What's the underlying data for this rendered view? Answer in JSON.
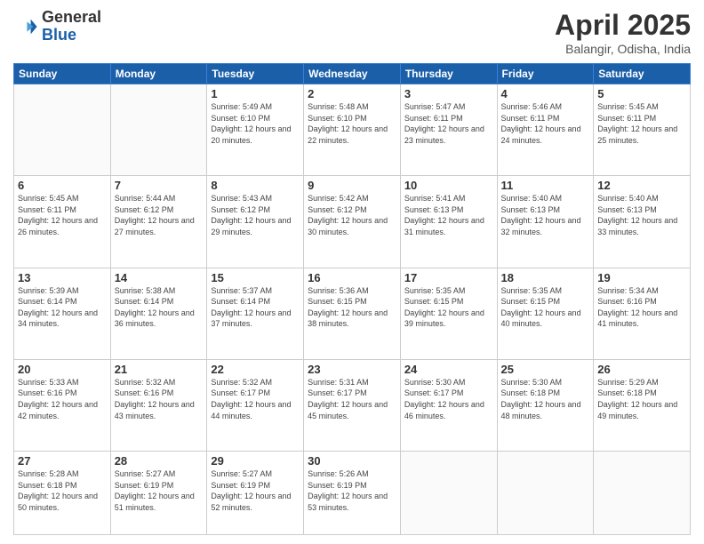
{
  "logo": {
    "general": "General",
    "blue": "Blue"
  },
  "title": "April 2025",
  "location": "Balangir, Odisha, India",
  "days_header": [
    "Sunday",
    "Monday",
    "Tuesday",
    "Wednesday",
    "Thursday",
    "Friday",
    "Saturday"
  ],
  "weeks": [
    [
      {
        "day": "",
        "info": ""
      },
      {
        "day": "",
        "info": ""
      },
      {
        "day": "1",
        "info": "Sunrise: 5:49 AM\nSunset: 6:10 PM\nDaylight: 12 hours and 20 minutes."
      },
      {
        "day": "2",
        "info": "Sunrise: 5:48 AM\nSunset: 6:10 PM\nDaylight: 12 hours and 22 minutes."
      },
      {
        "day": "3",
        "info": "Sunrise: 5:47 AM\nSunset: 6:11 PM\nDaylight: 12 hours and 23 minutes."
      },
      {
        "day": "4",
        "info": "Sunrise: 5:46 AM\nSunset: 6:11 PM\nDaylight: 12 hours and 24 minutes."
      },
      {
        "day": "5",
        "info": "Sunrise: 5:45 AM\nSunset: 6:11 PM\nDaylight: 12 hours and 25 minutes."
      }
    ],
    [
      {
        "day": "6",
        "info": "Sunrise: 5:45 AM\nSunset: 6:11 PM\nDaylight: 12 hours and 26 minutes."
      },
      {
        "day": "7",
        "info": "Sunrise: 5:44 AM\nSunset: 6:12 PM\nDaylight: 12 hours and 27 minutes."
      },
      {
        "day": "8",
        "info": "Sunrise: 5:43 AM\nSunset: 6:12 PM\nDaylight: 12 hours and 29 minutes."
      },
      {
        "day": "9",
        "info": "Sunrise: 5:42 AM\nSunset: 6:12 PM\nDaylight: 12 hours and 30 minutes."
      },
      {
        "day": "10",
        "info": "Sunrise: 5:41 AM\nSunset: 6:13 PM\nDaylight: 12 hours and 31 minutes."
      },
      {
        "day": "11",
        "info": "Sunrise: 5:40 AM\nSunset: 6:13 PM\nDaylight: 12 hours and 32 minutes."
      },
      {
        "day": "12",
        "info": "Sunrise: 5:40 AM\nSunset: 6:13 PM\nDaylight: 12 hours and 33 minutes."
      }
    ],
    [
      {
        "day": "13",
        "info": "Sunrise: 5:39 AM\nSunset: 6:14 PM\nDaylight: 12 hours and 34 minutes."
      },
      {
        "day": "14",
        "info": "Sunrise: 5:38 AM\nSunset: 6:14 PM\nDaylight: 12 hours and 36 minutes."
      },
      {
        "day": "15",
        "info": "Sunrise: 5:37 AM\nSunset: 6:14 PM\nDaylight: 12 hours and 37 minutes."
      },
      {
        "day": "16",
        "info": "Sunrise: 5:36 AM\nSunset: 6:15 PM\nDaylight: 12 hours and 38 minutes."
      },
      {
        "day": "17",
        "info": "Sunrise: 5:35 AM\nSunset: 6:15 PM\nDaylight: 12 hours and 39 minutes."
      },
      {
        "day": "18",
        "info": "Sunrise: 5:35 AM\nSunset: 6:15 PM\nDaylight: 12 hours and 40 minutes."
      },
      {
        "day": "19",
        "info": "Sunrise: 5:34 AM\nSunset: 6:16 PM\nDaylight: 12 hours and 41 minutes."
      }
    ],
    [
      {
        "day": "20",
        "info": "Sunrise: 5:33 AM\nSunset: 6:16 PM\nDaylight: 12 hours and 42 minutes."
      },
      {
        "day": "21",
        "info": "Sunrise: 5:32 AM\nSunset: 6:16 PM\nDaylight: 12 hours and 43 minutes."
      },
      {
        "day": "22",
        "info": "Sunrise: 5:32 AM\nSunset: 6:17 PM\nDaylight: 12 hours and 44 minutes."
      },
      {
        "day": "23",
        "info": "Sunrise: 5:31 AM\nSunset: 6:17 PM\nDaylight: 12 hours and 45 minutes."
      },
      {
        "day": "24",
        "info": "Sunrise: 5:30 AM\nSunset: 6:17 PM\nDaylight: 12 hours and 46 minutes."
      },
      {
        "day": "25",
        "info": "Sunrise: 5:30 AM\nSunset: 6:18 PM\nDaylight: 12 hours and 48 minutes."
      },
      {
        "day": "26",
        "info": "Sunrise: 5:29 AM\nSunset: 6:18 PM\nDaylight: 12 hours and 49 minutes."
      }
    ],
    [
      {
        "day": "27",
        "info": "Sunrise: 5:28 AM\nSunset: 6:18 PM\nDaylight: 12 hours and 50 minutes."
      },
      {
        "day": "28",
        "info": "Sunrise: 5:27 AM\nSunset: 6:19 PM\nDaylight: 12 hours and 51 minutes."
      },
      {
        "day": "29",
        "info": "Sunrise: 5:27 AM\nSunset: 6:19 PM\nDaylight: 12 hours and 52 minutes."
      },
      {
        "day": "30",
        "info": "Sunrise: 5:26 AM\nSunset: 6:19 PM\nDaylight: 12 hours and 53 minutes."
      },
      {
        "day": "",
        "info": ""
      },
      {
        "day": "",
        "info": ""
      },
      {
        "day": "",
        "info": ""
      }
    ]
  ]
}
